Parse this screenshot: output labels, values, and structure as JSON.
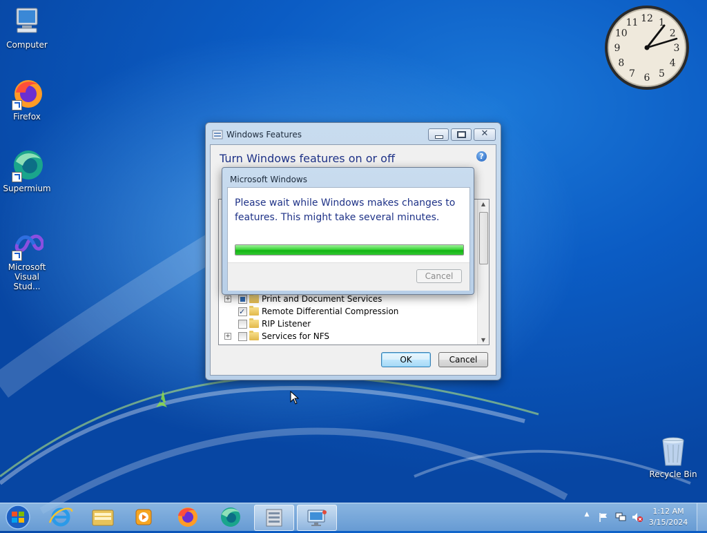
{
  "desktop": {
    "icons": [
      {
        "label": "Computer"
      },
      {
        "label": "Firefox"
      },
      {
        "label": "Supermium"
      },
      {
        "label": "Microsoft Visual Stud..."
      },
      {
        "label": "Recycle Bin"
      }
    ]
  },
  "clock": {
    "numerals": [
      "12",
      "1",
      "2",
      "3",
      "4",
      "5",
      "6",
      "7",
      "8",
      "9",
      "10",
      "11"
    ],
    "time": "1:12"
  },
  "features_window": {
    "title": "Windows Features",
    "heading": "Turn Windows features on or off",
    "help_icon": "?",
    "items": [
      {
        "label": "Print and Document Services",
        "state": "partial",
        "expandable": true
      },
      {
        "label": "Remote Differential Compression",
        "state": "checked",
        "expandable": false
      },
      {
        "label": "RIP Listener",
        "state": "unchecked",
        "expandable": false
      },
      {
        "label": "Services for NFS",
        "state": "unchecked",
        "expandable": true
      }
    ],
    "ok_label": "OK",
    "cancel_label": "Cancel"
  },
  "progress_dialog": {
    "title": "Microsoft Windows",
    "message": "Please wait while Windows makes changes to features. This might take several minutes.",
    "progress": 1.0,
    "cancel_label": "Cancel"
  },
  "taskbar": {
    "items": [
      "start-orb",
      "internet-explorer",
      "windows-explorer",
      "media-player",
      "firefox",
      "supermium",
      "windows-features-task",
      "control-panel-task"
    ],
    "time": "1:12 AM",
    "date": "3/15/2024"
  },
  "colors": {
    "progress": "#22c02c",
    "heading": "#1e3287",
    "desktop": "#0b5cc4"
  }
}
